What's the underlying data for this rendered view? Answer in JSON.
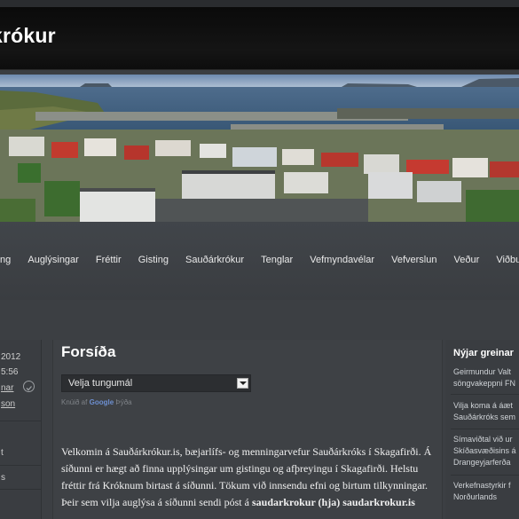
{
  "site": {
    "title": "krókur"
  },
  "nav": {
    "items": [
      "eying",
      "Auglýsingar",
      "Fréttir",
      "Gisting",
      "Sauðárkrókur",
      "Tenglar",
      "Vefmyndavélar",
      "Vefverslun",
      "Veður",
      "Viðburðir"
    ]
  },
  "left": {
    "date": "2012",
    "time": "5:56",
    "link1": "nar",
    "link2": "son",
    "menu1": "t",
    "menu2": "s"
  },
  "main": {
    "title": "Forsíða",
    "language_select": "Velja tungumál",
    "powered_prefix": "Knúið af",
    "powered_brand": "Google",
    "powered_suffix": "Þýða",
    "paragraph1": "Velkomin á Sauðárkrókur.is, bæjarlífs- og menningarvefur Sauðárkróks í Skagafirði. Á síðunni er hægt að finna upplýsingar um gistingu og afþreyingu í Skagafirði.  Helstu fréttir frá Króknum birtast á síðunni. Tökum við innsendu efni og birtum tilkynningar.  Þeir sem vilja auglýsa á síðunni sendi póst á",
    "email": "saudarkrokur (hja) saudarkrokur.is"
  },
  "sidebar": {
    "title": "Nýjar greinar",
    "items": [
      [
        "Geirmundur Valt",
        "söngvakeppni FN"
      ],
      [
        "Vilja koma á áæt",
        "Sauðárkróks sem"
      ],
      [
        "Símaviðtal við ur",
        "Skíðasvæðisins á",
        "Drangeyjarferða"
      ],
      [
        "Verkefnastyrkir f",
        "Norðurlands"
      ]
    ]
  }
}
